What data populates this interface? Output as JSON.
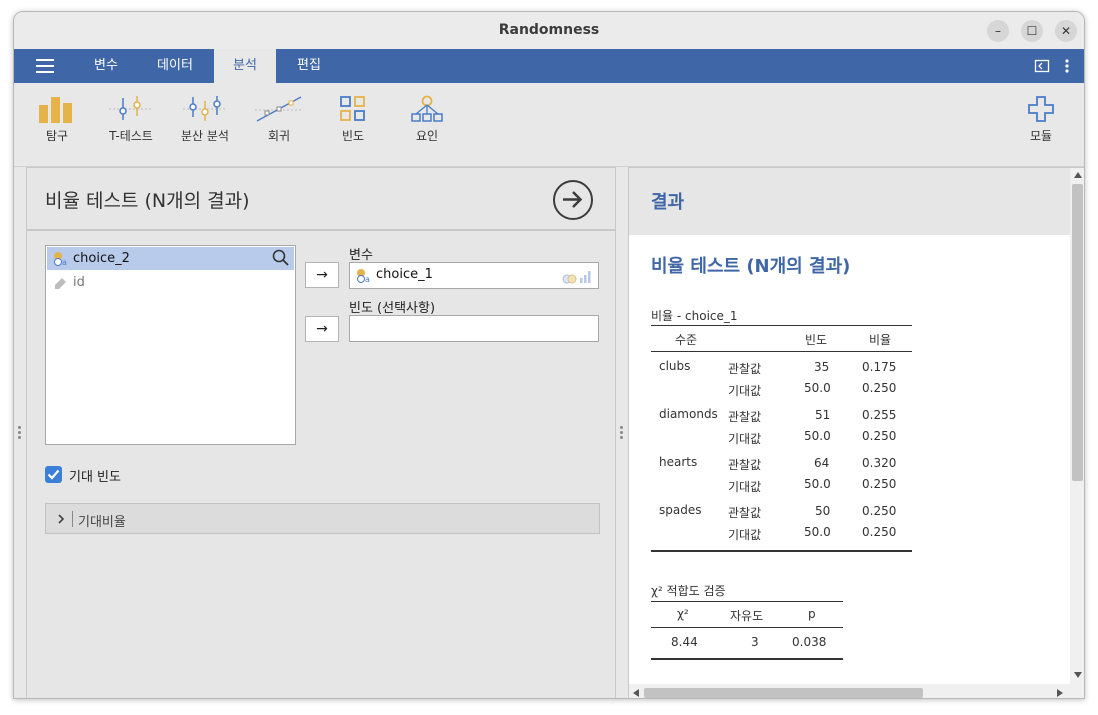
{
  "window": {
    "title": "Randomness",
    "controls": [
      "–",
      "☐",
      "✕"
    ]
  },
  "menubar": {
    "tabs": [
      {
        "label": "변수",
        "active": false
      },
      {
        "label": "데이터",
        "active": false
      },
      {
        "label": "분석",
        "active": true
      },
      {
        "label": "편집",
        "active": false
      }
    ]
  },
  "ribbon": {
    "items": [
      {
        "label": "탐구",
        "icon": "bar-chart-icon"
      },
      {
        "label": "T-테스트",
        "icon": "t-test-icon"
      },
      {
        "label": "분산 분석",
        "icon": "anova-icon"
      },
      {
        "label": "회귀",
        "icon": "regression-icon"
      },
      {
        "label": "빈도",
        "icon": "frequencies-icon"
      },
      {
        "label": "요인",
        "icon": "factor-icon"
      }
    ],
    "modules_label": "모듈"
  },
  "options": {
    "heading": "비율 테스트 (N개의 결과)",
    "variables": [
      "choice_2",
      "id"
    ],
    "var_label": "변수",
    "var_value": "choice_1",
    "freq_label": "빈도 (선택사항)",
    "freq_value": "",
    "expected_checkbox": {
      "label": "기대 빈도",
      "checked": true
    },
    "expected_ratio_label": "기대비율"
  },
  "results": {
    "header": "결과",
    "title": "비율 테스트 (N개의 결과)",
    "prop_table": {
      "caption": "비율 - choice_1",
      "columns": [
        "수준",
        "빈도",
        "비율"
      ],
      "rows": [
        {
          "level": "clubs",
          "obs_label": "관찰값",
          "obs_n": "35",
          "obs_p": "0.175",
          "exp_label": "기대값",
          "exp_n": "50.0",
          "exp_p": "0.250"
        },
        {
          "level": "diamonds",
          "obs_label": "관찰값",
          "obs_n": "51",
          "obs_p": "0.255",
          "exp_label": "기대값",
          "exp_n": "50.0",
          "exp_p": "0.250"
        },
        {
          "level": "hearts",
          "obs_label": "관찰값",
          "obs_n": "64",
          "obs_p": "0.320",
          "exp_label": "기대값",
          "exp_n": "50.0",
          "exp_p": "0.250"
        },
        {
          "level": "spades",
          "obs_label": "관찰값",
          "obs_n": "50",
          "obs_p": "0.250",
          "exp_label": "기대값",
          "exp_n": "50.0",
          "exp_p": "0.250"
        }
      ]
    },
    "chisq_table": {
      "caption": "χ² 적합도 검증",
      "columns": [
        "χ²",
        "자유도",
        "p"
      ],
      "row": [
        "8.44",
        "3",
        "0.038"
      ]
    }
  },
  "colors": {
    "accent": "#3f66a6",
    "selected_row": "#b9cbeb",
    "checkbox": "#3b7fd9"
  }
}
